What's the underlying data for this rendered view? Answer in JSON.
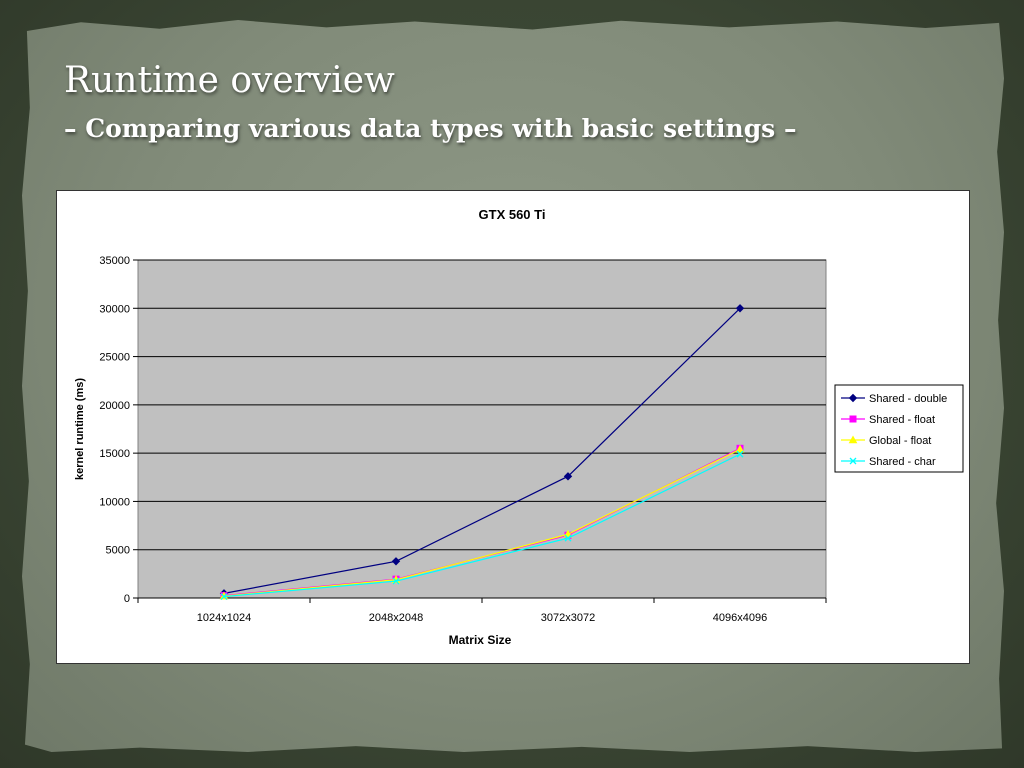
{
  "slide": {
    "title": "Runtime overview",
    "subtitle": "– Comparing various data types with basic settings –"
  },
  "colors": {
    "plot_bg": "#c0c0c0",
    "series": [
      "#000080",
      "#ff00ff",
      "#ffff00",
      "#00ffff"
    ]
  },
  "chart_data": {
    "type": "line",
    "title": "GTX 560 Ti",
    "xlabel": "Matrix Size",
    "ylabel": "kernel runtime (ms)",
    "categories": [
      "1024x1024",
      "2048x2048",
      "3072x3072",
      "4096x4096"
    ],
    "ylim": [
      0,
      35000
    ],
    "yticks": [
      "0",
      "5000",
      "10000",
      "15000",
      "20000",
      "25000",
      "30000",
      "35000"
    ],
    "grid": true,
    "legend": "right",
    "series": [
      {
        "name": "Shared - double",
        "marker": "diamond",
        "values": [
          480,
          3800,
          12600,
          30000
        ]
      },
      {
        "name": "Shared - float",
        "marker": "square",
        "values": [
          250,
          1950,
          6500,
          15500
        ]
      },
      {
        "name": "Global - float",
        "marker": "triangle",
        "values": [
          200,
          1900,
          6600,
          15400
        ]
      },
      {
        "name": "Shared - char",
        "marker": "x",
        "values": [
          150,
          1750,
          6200,
          14900
        ]
      }
    ]
  }
}
